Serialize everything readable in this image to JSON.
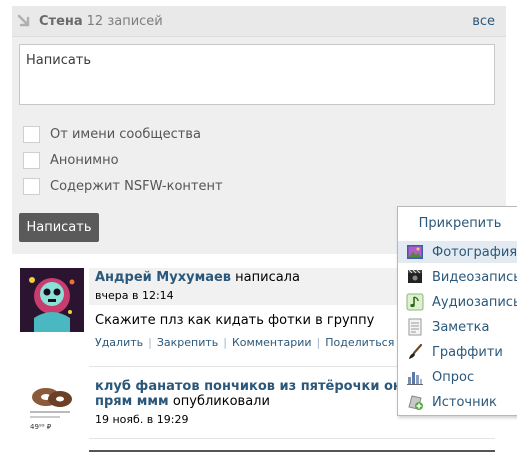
{
  "wall": {
    "title": "Стена",
    "count": "12 записей",
    "all_link": "все"
  },
  "composer": {
    "placeholder": "Написать",
    "options": [
      {
        "label": "От имени сообщества",
        "checked": false
      },
      {
        "label": "Анонимно",
        "checked": false
      },
      {
        "label": "Содержит NSFW-контент",
        "checked": false
      }
    ],
    "submit_label": "Написать"
  },
  "attach_menu": {
    "title": "Прикрепить",
    "items": [
      {
        "label": "Фотография",
        "icon": "photo-icon",
        "active": true
      },
      {
        "label": "Видеозапись",
        "icon": "video-icon",
        "active": false
      },
      {
        "label": "Аудиозапись",
        "icon": "audio-icon",
        "active": false
      },
      {
        "label": "Заметка",
        "icon": "note-icon",
        "active": false
      },
      {
        "label": "Граффити",
        "icon": "brush-icon",
        "active": false
      },
      {
        "label": "Опрос",
        "icon": "poll-icon",
        "active": false
      },
      {
        "label": "Источник",
        "icon": "source-icon",
        "active": false
      }
    ]
  },
  "posts": [
    {
      "author": "Андрей Мухумаев",
      "verb": "написала",
      "time": "вчера в 12:14",
      "text": "Скажите плз как кидать фотки в группу",
      "actions": [
        "Удалить",
        "Закрепить",
        "Комментарии",
        "Поделиться"
      ]
    },
    {
      "author": "клуб фанатов пончиков из пятёрочки они вкусные прям ммм",
      "verb": "опубликовали",
      "time": "19 нояб. в 19:29",
      "avatar_caption": "49⁹⁹ ₽"
    }
  ],
  "colors": {
    "link": "#2b587a",
    "header_bg": "#e9e9e9",
    "composer_bg": "#efefef",
    "button_bg": "#5a5a5a",
    "menu_active_bg": "#e4eaf1"
  }
}
